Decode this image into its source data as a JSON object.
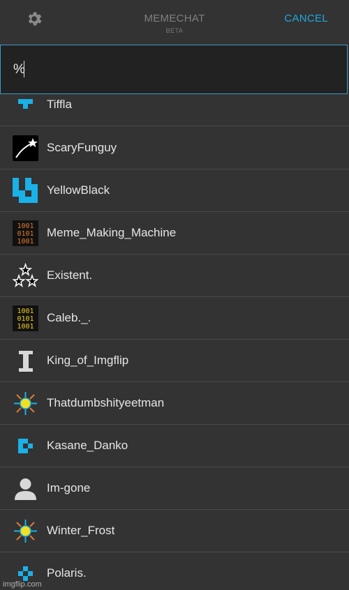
{
  "header": {
    "app_title": "MEMECHAT",
    "app_subtitle": "BETA",
    "cancel_label": "CANCEL"
  },
  "search": {
    "value": "%"
  },
  "users": [
    {
      "name": "Tiffla",
      "avatar": "blue-t-block-icon"
    },
    {
      "name": "ScaryFunguy",
      "avatar": "shooting-star-icon"
    },
    {
      "name": "YellowBlack",
      "avatar": "blue-pixel-pattern-icon"
    },
    {
      "name": "Meme_Making_Machine",
      "avatar": "binary-orange-icon"
    },
    {
      "name": "Existent.",
      "avatar": "three-stars-icon"
    },
    {
      "name": "Caleb._.",
      "avatar": "binary-yellow-icon"
    },
    {
      "name": "King_of_Imgflip",
      "avatar": "letter-i-icon"
    },
    {
      "name": "Thatdumbshityeetman",
      "avatar": "sun-burst-icon"
    },
    {
      "name": "Kasane_Danko",
      "avatar": "blue-pixel-icon"
    },
    {
      "name": "Im-gone",
      "avatar": "default-user-icon"
    },
    {
      "name": "Winter_Frost",
      "avatar": "sun-burst-icon"
    },
    {
      "name": "Polaris.",
      "avatar": "blue-diamond-icon"
    }
  ],
  "watermark": "imgflip.com",
  "colors": {
    "accent": "#1fa8e0",
    "background": "#333333",
    "search_bg": "#222222"
  }
}
